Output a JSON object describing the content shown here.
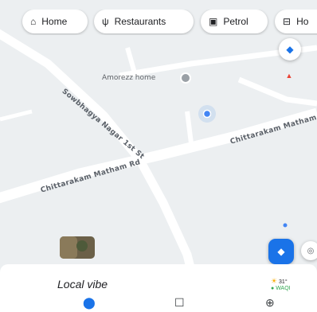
{
  "chips": [
    {
      "label": "Home",
      "icon": "home-icon"
    },
    {
      "label": "Restaurants",
      "icon": "cutlery-icon"
    },
    {
      "label": "Petrol",
      "icon": "fuel-icon"
    },
    {
      "label": "Ho",
      "icon": "hotel-icon"
    }
  ],
  "map": {
    "place_label": "Amorezz home",
    "road_labels": [
      "Sowbhagya Nagar 1st St",
      "Chittarakam Matham Rd",
      "Chittarakam Matham Rd"
    ]
  },
  "bottom": {
    "title": "Local vibe",
    "weather_temp": "31°",
    "weather_aqi": "WAQI"
  },
  "colors": {
    "accent": "#1a73e8",
    "fab_blue": "#1a73e8",
    "pin_red": "#ea4335"
  }
}
